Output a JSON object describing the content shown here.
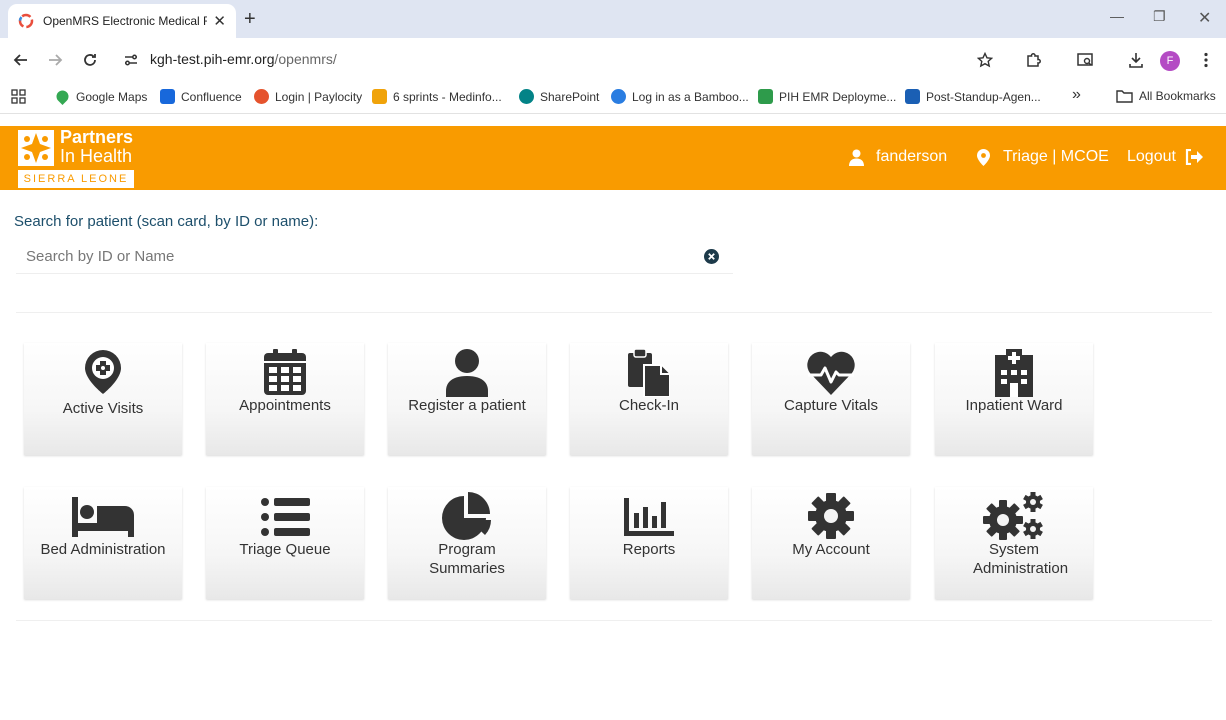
{
  "browser": {
    "tab_title": "OpenMRS Electronic Medical R",
    "url_host": "kgh-test.pih-emr.org",
    "url_path": "/openmrs/",
    "profile_initial": "F",
    "bookmarks": [
      {
        "label": "Google Maps",
        "color": "#34a853"
      },
      {
        "label": "Confluence",
        "color": "#1868db"
      },
      {
        "label": "Login | Paylocity",
        "color": "#e5532d"
      },
      {
        "label": "6 sprints - Medinfo...",
        "color": "#f0a30a"
      },
      {
        "label": "SharePoint",
        "color": "#038387"
      },
      {
        "label": "Log in as a Bamboo...",
        "color": "#2a7de1"
      },
      {
        "label": "PIH EMR Deployme...",
        "color": "#2e9b4b"
      },
      {
        "label": "Post-Standup-Agen...",
        "color": "#1a5fb4"
      }
    ],
    "more_bookmarks": "»",
    "all_bookmarks": "All Bookmarks"
  },
  "header": {
    "logo_line1": "Partners",
    "logo_line2": "In Health",
    "logo_band": "SIERRA LEONE",
    "username": "fanderson",
    "location": "Triage | MCOE",
    "logout": "Logout"
  },
  "search": {
    "label": "Search for patient (scan card, by ID or name):",
    "placeholder": "Search by ID or Name"
  },
  "apps": [
    {
      "label": "Active Visits",
      "icon": "map-marker-hospital-icon"
    },
    {
      "label": "Appointments",
      "icon": "calendar-icon"
    },
    {
      "label": "Register a patient",
      "icon": "user-icon"
    },
    {
      "label": "Check-In",
      "icon": "clipboard-copy-icon"
    },
    {
      "label": "Capture Vitals",
      "icon": "heartbeat-icon"
    },
    {
      "label": "Inpatient Ward",
      "icon": "hospital-building-icon"
    },
    {
      "label": "Bed Administration",
      "icon": "bed-icon"
    },
    {
      "label": "Triage Queue",
      "icon": "list-icon"
    },
    {
      "label": "Program Summaries",
      "icon": "pie-chart-icon"
    },
    {
      "label": "Reports",
      "icon": "bar-chart-icon"
    },
    {
      "label": "My Account",
      "icon": "gear-icon"
    },
    {
      "label": "System Administration",
      "icon": "gears-icon"
    }
  ],
  "colors": {
    "brand_orange": "#f99b00",
    "search_label": "#1d4f6b",
    "icon_dark": "#333333"
  }
}
